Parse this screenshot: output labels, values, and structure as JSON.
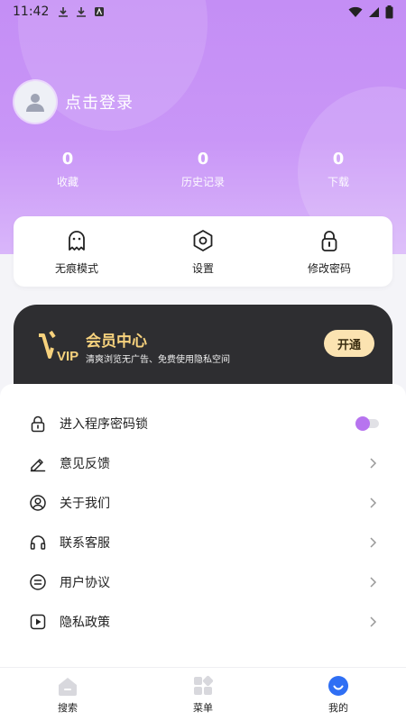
{
  "status_bar": {
    "time": "11:42"
  },
  "login": {
    "text": "点击登录"
  },
  "stats": [
    {
      "value": "0",
      "label": "收藏"
    },
    {
      "value": "0",
      "label": "历史记录"
    },
    {
      "value": "0",
      "label": "下载"
    }
  ],
  "quick_actions": [
    {
      "label": "无痕模式",
      "icon": "ghost-icon"
    },
    {
      "label": "设置",
      "icon": "hexagon-settings-icon"
    },
    {
      "label": "修改密码",
      "icon": "lock-icon"
    }
  ],
  "vip": {
    "logo_text": "VIP",
    "title": "会员中心",
    "subtitle": "清爽浏览无广告、免费使用隐私空间",
    "button": "开通"
  },
  "menu": [
    {
      "label": "进入程序密码锁",
      "icon": "lock-icon",
      "type": "toggle"
    },
    {
      "label": "意见反馈",
      "icon": "eraser-icon",
      "type": "link"
    },
    {
      "label": "关于我们",
      "icon": "user-circle-icon",
      "type": "link"
    },
    {
      "label": "联系客服",
      "icon": "headphones-icon",
      "type": "link"
    },
    {
      "label": "用户协议",
      "icon": "agreement-icon",
      "type": "link"
    },
    {
      "label": "隐私政策",
      "icon": "play-box-icon",
      "type": "link"
    }
  ],
  "tabs": [
    {
      "label": "搜索",
      "icon": "home-icon"
    },
    {
      "label": "菜单",
      "icon": "grid-icon"
    },
    {
      "label": "我的",
      "icon": "smile-icon",
      "active": true
    }
  ],
  "colors": {
    "accent": "#b774ef",
    "header": "#c996f7",
    "vip_bg": "#2e2e31",
    "vip_gold": "#f7d27d",
    "vip_button": "#fbe3b1",
    "tab_active": "#2f6ff4"
  }
}
